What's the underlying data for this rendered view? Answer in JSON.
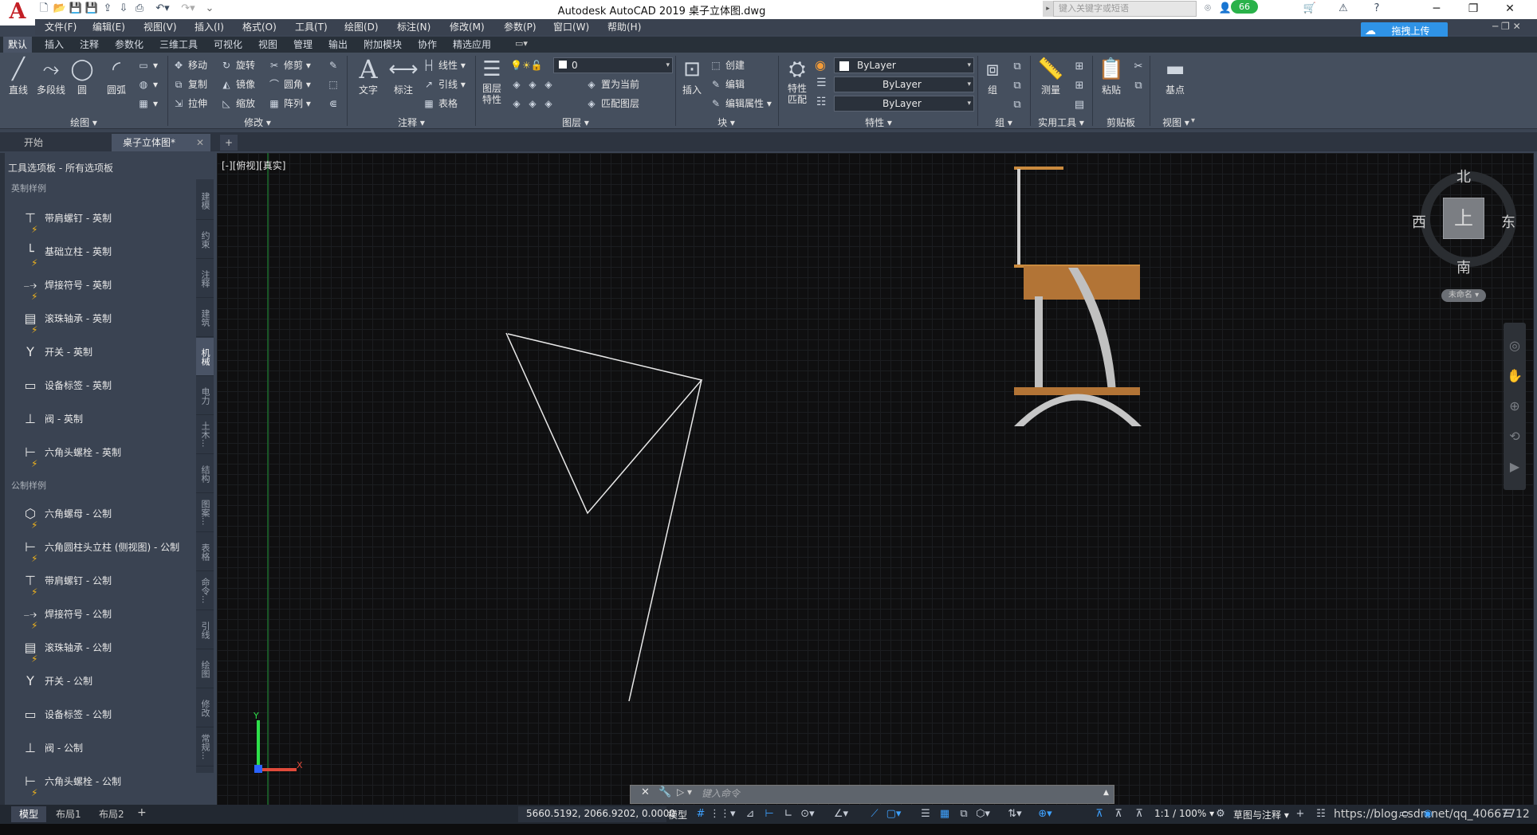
{
  "title": "Autodesk AutoCAD 2019    桌子立体图.dwg",
  "search": {
    "placeholder": "键入关键字或短语"
  },
  "notify_count": "66",
  "upload_button": "拖拽上传",
  "menus": [
    "文件(F)",
    "编辑(E)",
    "视图(V)",
    "插入(I)",
    "格式(O)",
    "工具(T)",
    "绘图(D)",
    "标注(N)",
    "修改(M)",
    "参数(P)",
    "窗口(W)",
    "帮助(H)"
  ],
  "ribbon_tabs": [
    "默认",
    "插入",
    "注释",
    "参数化",
    "三维工具",
    "可视化",
    "视图",
    "管理",
    "输出",
    "附加模块",
    "协作",
    "精选应用"
  ],
  "ribbon": {
    "draw": {
      "panel": "绘图 ▾",
      "line": "直线",
      "polyline": "多段线",
      "circle": "圆",
      "arc": "圆弧"
    },
    "modify": {
      "panel": "修改 ▾",
      "move": "移动",
      "rotate": "旋转",
      "trim": "修剪",
      "copy": "复制",
      "mirror": "镜像",
      "fillet": "圆角",
      "stretch": "拉伸",
      "scale": "缩放",
      "array": "阵列"
    },
    "annotation": {
      "panel": "注释 ▾",
      "text": "文字",
      "dimension": "标注",
      "linear": "线性",
      "leader": "引线",
      "table": "表格"
    },
    "layers": {
      "panel": "图层 ▾",
      "properties": "图层\n特性",
      "current_layer": "0",
      "set_current": "置为当前",
      "match_layer": "匹配图层"
    },
    "block": {
      "panel": "块 ▾",
      "insert": "插入",
      "create": "创建",
      "edit": "编辑",
      "edit_attr": "编辑属性"
    },
    "properties": {
      "panel": "特性 ▾",
      "match": "特性\n匹配",
      "color": "ByLayer",
      "linetype": "ByLayer",
      "lineweight": "ByLayer"
    },
    "groups": {
      "panel": "组 ▾",
      "group": "组"
    },
    "utilities": {
      "panel": "实用工具 ▾",
      "measure": "测量"
    },
    "clipboard": {
      "panel": "剪贴板",
      "paste": "粘贴"
    },
    "view": {
      "panel": "视图 ▾",
      "base": "基点"
    }
  },
  "file_tabs": [
    "开始",
    "桌子立体图*"
  ],
  "palette": {
    "header": "工具选项板 - 所有选项板",
    "imperial_section": "英制样例",
    "imperial": [
      "带肩螺钉 - 英制",
      "基础立柱 - 英制",
      "焊接符号 - 英制",
      "滚珠轴承 - 英制",
      "开关 - 英制",
      "设备标签 - 英制",
      "阀 - 英制",
      "六角头螺栓 - 英制"
    ],
    "metric_section": "公制样例",
    "metric": [
      "六角螺母 - 公制",
      "六角圆柱头立柱 (侧视图) - 公制",
      "带肩螺钉 - 公制",
      "焊接符号 - 公制",
      "滚珠轴承 - 公制",
      "开关 - 公制",
      "设备标签 - 公制",
      "阀 - 公制",
      "六角头螺栓 - 公制"
    ],
    "side_tabs": [
      "建模",
      "约束",
      "注释",
      "建筑",
      "机械",
      "电力",
      "土木...",
      "结构",
      "图案...",
      "表格",
      "命令...",
      "引线",
      "绘图",
      "修改",
      "常规..."
    ]
  },
  "viewport_label": "[-][俯视][真实]",
  "viewcube": {
    "top": "上",
    "north": "北",
    "south": "南",
    "east": "东",
    "west": "西",
    "ucs": "未命名 ▾"
  },
  "command": {
    "placeholder": "键入命令",
    "prompt": "▷ ▾"
  },
  "layout_tabs": [
    "模型",
    "布局1",
    "布局2"
  ],
  "status": {
    "coords": "5660.5192, 2066.9202, 0.0000",
    "model": "模型",
    "scale": "1:1 / 100% ▾",
    "annotate": "草图与注释 ▾",
    "watermark": "https://blog.csdn.net/qq_40667712"
  }
}
